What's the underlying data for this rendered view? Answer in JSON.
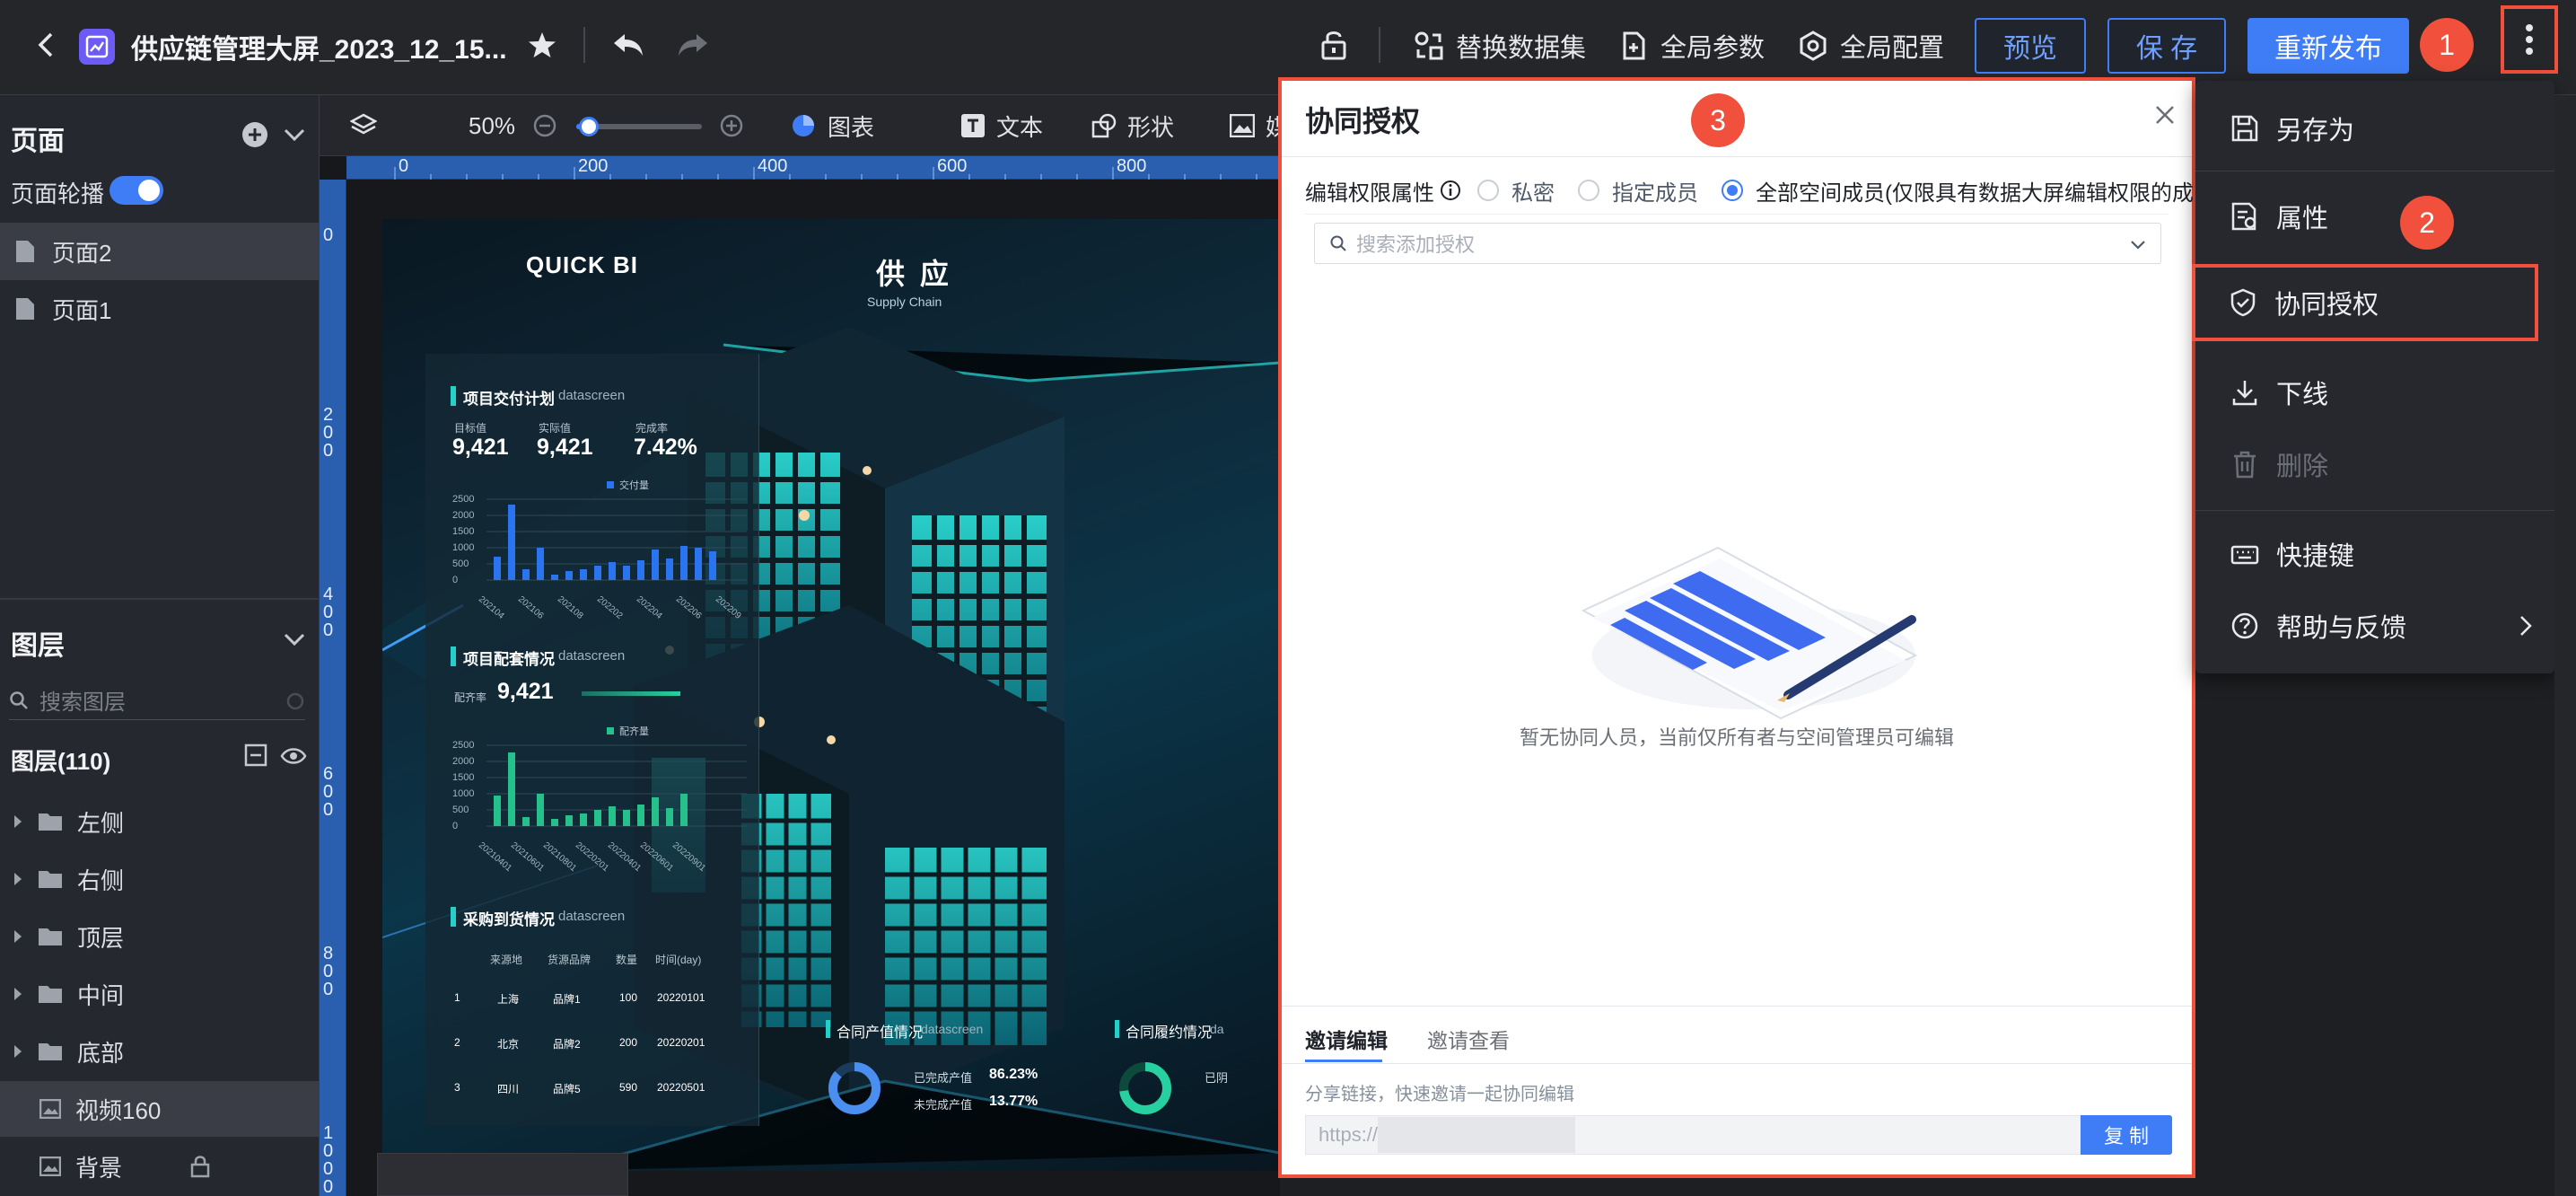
{
  "topbar": {
    "title": "供应链管理大屏_2023_12_15...",
    "replace_dataset": "替换数据集",
    "global_params": "全局参数",
    "global_config": "全局配置",
    "preview": "预览",
    "save": "保 存",
    "republish": "重新发布"
  },
  "badges": {
    "one": "1",
    "two": "2",
    "three": "3"
  },
  "left": {
    "pages_title": "页面",
    "carousel_label": "页面轮播",
    "pages": [
      "页面2",
      "页面1"
    ],
    "layers_title": "图层",
    "layer_search_placeholder": "搜索图层",
    "layer_count_label": "图层(110)",
    "layers": [
      {
        "name": "左侧",
        "type": "folder"
      },
      {
        "name": "右侧",
        "type": "folder"
      },
      {
        "name": "顶层",
        "type": "folder"
      },
      {
        "name": "中间",
        "type": "folder"
      },
      {
        "name": "底部",
        "type": "folder"
      },
      {
        "name": "视频160",
        "type": "image"
      },
      {
        "name": "背景",
        "type": "image"
      }
    ]
  },
  "toolbar": {
    "zoom": "50%",
    "zoom_level": 0.1,
    "chart": "图表",
    "text": "文本",
    "shape": "形状",
    "media_partial": "媒"
  },
  "ruler": {
    "top_ticks": [
      "0",
      "200",
      "400",
      "600",
      "800"
    ],
    "left_ticks": [
      "0",
      "200",
      "400",
      "600",
      "800",
      "1000"
    ]
  },
  "canvas": {
    "brand": "QUICK BI",
    "title_partial": "供 应",
    "subtitle_partial": "Supply Chain",
    "panel1": {
      "title": "项目交付计划",
      "tag": "datascreen",
      "kpi_labels": [
        "目标值",
        "实际值",
        "完成率"
      ],
      "kpi_values": [
        "9,421",
        "9,421",
        "7.42%"
      ],
      "legend": "交付量",
      "y_ticks": [
        "2500",
        "2000",
        "1500",
        "1000",
        "500",
        "0"
      ],
      "x_ticks": [
        "202104",
        "202106",
        "202108",
        "202202",
        "202204",
        "202206",
        "202209"
      ]
    },
    "panel2": {
      "title": "项目配套情况",
      "tag": "datascreen",
      "kpi_label": "配齐率",
      "kpi_value": "9,421",
      "legend": "配齐量",
      "y_ticks": [
        "2500",
        "2000",
        "1500",
        "1000",
        "500",
        "0"
      ],
      "x_ticks": [
        "20210401",
        "20210601",
        "20210801",
        "20220201",
        "20220401",
        "20220601",
        "20220901"
      ]
    },
    "panel3": {
      "title": "采购到货情况",
      "tag": "datascreen",
      "headers": [
        "来源地",
        "货源品牌",
        "数量",
        "时间(day)"
      ],
      "rows": [
        [
          "1",
          "上海",
          "品牌1",
          "100",
          "20220101"
        ],
        [
          "2",
          "北京",
          "品牌2",
          "200",
          "20220201"
        ],
        [
          "3",
          "四川",
          "品牌5",
          "590",
          "20220501"
        ]
      ]
    },
    "panel4": {
      "title": "合同产值情况",
      "tag": "datascreen",
      "done_label": "已完成产值",
      "done_value": "86.23%",
      "undone_label": "未完成产值",
      "undone_value": "13.77%"
    },
    "panel5": {
      "title": "合同履约情况",
      "tag_partial": "da",
      "label_partial": "已阴"
    }
  },
  "dialog": {
    "title": "协同授权",
    "perm_label": "编辑权限属性",
    "options": [
      "私密",
      "指定成员",
      "全部空间成员(仅限具有数据大屏编辑权限的成员)"
    ],
    "selected_option": "全部空间成员(仅限具有数据大屏编辑权限的成员)",
    "search_placeholder": "搜索添加授权",
    "empty_text": "暂无协同人员，当前仅所有者与空间管理员可编辑",
    "tabs": [
      "邀请编辑",
      "邀请查看"
    ],
    "share_hint": "分享链接，快速邀请一起协同编辑",
    "link_prefix": "https://",
    "copy": "复 制"
  },
  "menu": {
    "items": [
      "另存为",
      "属性",
      "协同授权",
      "下线",
      "删除",
      "快捷键",
      "帮助与反馈"
    ]
  },
  "colors": {
    "accent": "#3f7df6",
    "highlight_border": "#f0503c",
    "badge": "#f0503c",
    "topbar_bg": "#24262a",
    "canvas_teal": "#26d0c8"
  }
}
